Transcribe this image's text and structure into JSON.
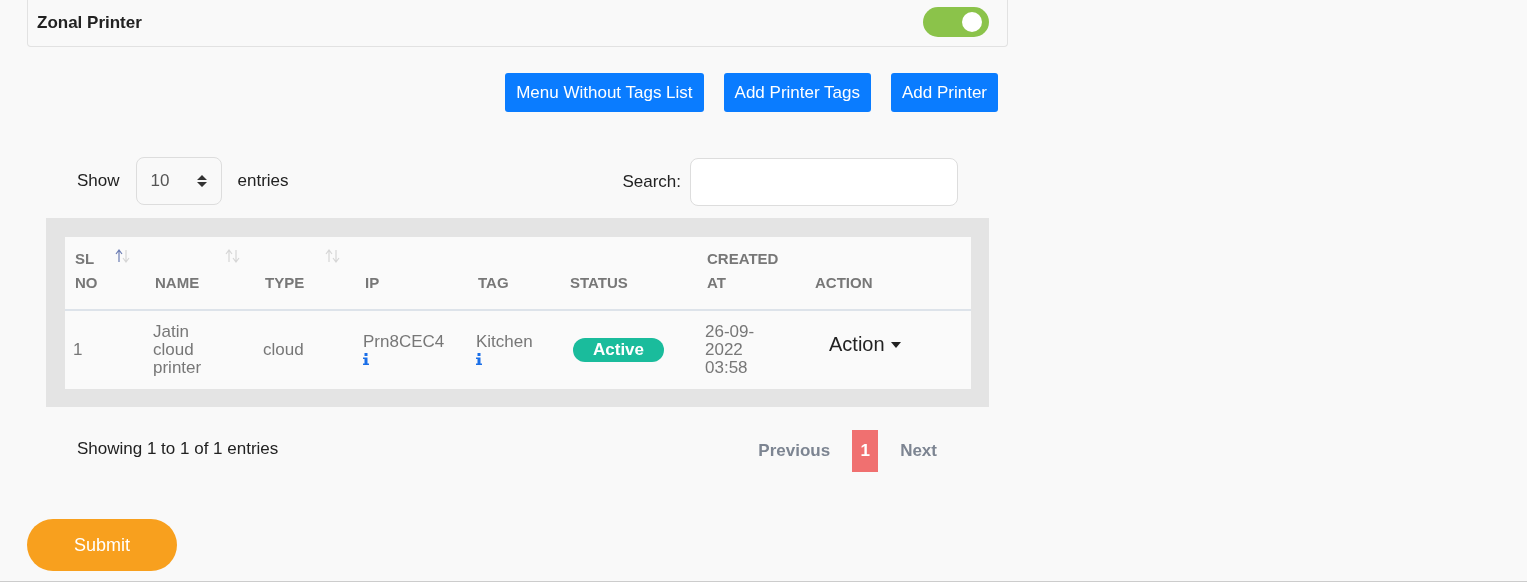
{
  "zonal_printer": {
    "label": "Zonal Printer",
    "on": true
  },
  "buttons": [
    "Menu Without Tags List",
    "Add Printer Tags",
    "Add Printer"
  ],
  "length_menu": {
    "before": "Show",
    "value": "10",
    "after": "entries"
  },
  "search": {
    "label": "Search:"
  },
  "table": {
    "columns": [
      {
        "label": "SL NO",
        "sorted": true
      },
      {
        "label": "NAME",
        "sorted": false
      },
      {
        "label": "TYPE",
        "sorted": false
      },
      {
        "label": "IP"
      },
      {
        "label": "TAG"
      },
      {
        "label": "STATUS"
      },
      {
        "label": "CREATED AT"
      },
      {
        "label": "ACTION"
      }
    ],
    "rows": [
      {
        "sl_no": "1",
        "name": "Jatin cloud printer",
        "type": "cloud",
        "ip": "Prn8CEC4",
        "tag": "Kitchen",
        "status": "Active",
        "created_at": "26-09-2022 03:58",
        "action": "Action"
      }
    ]
  },
  "info": "Showing 1 to 1 of 1 entries",
  "pagination": {
    "previous": "Previous",
    "pages": [
      {
        "label": "1",
        "selected": true
      }
    ],
    "next": "Next"
  },
  "submit": "Submit"
}
